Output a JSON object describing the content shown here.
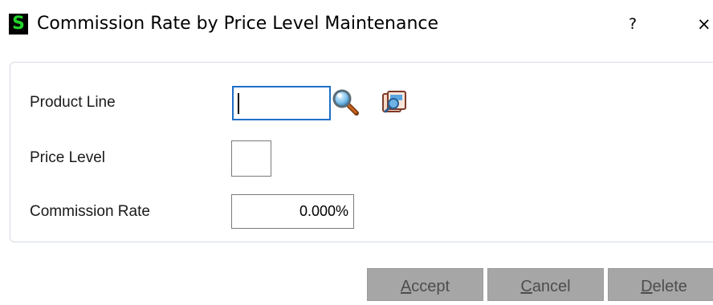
{
  "window": {
    "title": "Commission Rate by Price Level Maintenance",
    "app_icon_letter": "S",
    "help_label": "?",
    "close_label": "×"
  },
  "form": {
    "product_line": {
      "label": "Product Line",
      "value": ""
    },
    "price_level": {
      "label": "Price Level",
      "value": ""
    },
    "commission_rate": {
      "label": "Commission Rate",
      "value": "0.000%"
    }
  },
  "icons": {
    "lookup": "magnifier-lookup-icon",
    "browse": "browse-list-icon"
  },
  "buttons": {
    "accept": {
      "mnemonic": "A",
      "rest": "ccept",
      "enabled": false
    },
    "cancel": {
      "mnemonic": "C",
      "rest": "ancel",
      "enabled": false
    },
    "delete": {
      "mnemonic": "D",
      "rest": "elete",
      "enabled": false
    }
  },
  "colors": {
    "focus_border": "#1e6fc8",
    "disabled_button": "#a6a6a6",
    "app_icon_fg": "#22d42a"
  }
}
